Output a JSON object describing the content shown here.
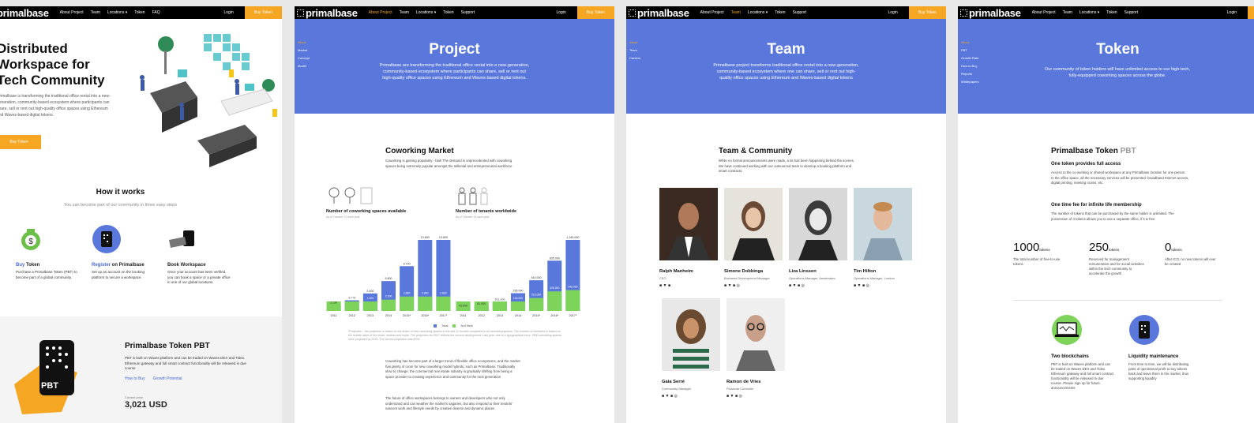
{
  "nav": {
    "logo": "primalbase",
    "about": "About Project",
    "team": "Team",
    "locations": "Locations ▾",
    "token": "Token",
    "faq": "FAQ",
    "support": "Support",
    "login": "Login",
    "buy": "Buy Token"
  },
  "home": {
    "hero_title": "Distributed Workspace for Tech Community",
    "hero_desc": "Primalbase is transforming the traditional office rental into a new-generation, community-based ecosystem where participants can share, sell or rent out high-quality office spaces using Ethereum and Waves-based digital tokens.",
    "hero_button": "Buy Token",
    "how_title": "How it works",
    "how_sub": "You can become part of our community in three easy steps",
    "steps": [
      {
        "hl": "Buy",
        "rest": " Token",
        "desc": "Purchase a Primalbase Token (PBT) to become part of a global community."
      },
      {
        "hl": "Register",
        "rest": " on Primalbase",
        "desc": "Set up an account on the booking platform to secure a workspace."
      },
      {
        "hl": "",
        "rest": "Book Workspace",
        "desc": "Once your account has been verified, you can book a space or a private office in one of our global locations."
      }
    ],
    "pbt_badge": "PBT",
    "pbt_title": "Primalbase Token PBT",
    "pbt_desc": "PBT is built on Waves platform and can be traded on Waves DEX and Tidex. Ethereum gateway and full smart contract functionality will be released in due course",
    "link_how": "How to Buy",
    "link_growth": "Growth Potential",
    "cap_label": "Current price",
    "cap_value": "3,021 USD"
  },
  "project": {
    "side": [
      "About",
      "Market",
      "Concept",
      "Model"
    ],
    "title": "Project",
    "desc": "Primalbase are transforming the traditional office rental into a new-generation, community-based ecosystem where participants can share, sell or rent out high-quality office spaces using Ethereum and Waves-based digital tokens.",
    "market_title": "Coworking Market",
    "market_desc": "Coworking is gaining popularity - fast! The demand is unprecedented with coworking spaces being extremely popular amongst the millenial and entrepreneurial workforce",
    "chart1_title": "Number of coworking spaces available",
    "chart1_sub": "As of October 31 each year",
    "chart2_title": "Number of tenants worldwide",
    "chart2_sub": "As of October 31 each year",
    "legend_total": "Total",
    "legend_new": "Not New",
    "footnote": "*Projection - the projection is based on the share of new coworking spaces in the last 12 months compared to all coworking spaces. The number of members is based on the middle value of the mean, median and mode. The projection for 2017 reflects the current development. Last year, due to a typographical error, 7800 coworking spaces were projected by 2016. The correct projection was 8700.",
    "para1": "Coworking has become part of a larger trend of flexible office ecosystems, and the market has plenty of room for new coworking model hybrids, such as Primalbase. Traditionally slow to change, the commercial real estate industry is gradually shifting from being a space provider to creating experience and community for the next generation",
    "para2": "The future of office workspaces belongs to owners and developers who not only understand and can weather the market's vagaries, but also respond to their tenants' nascent work and lifestyle needs by creative diverse and dynamic places"
  },
  "chart_data": [
    {
      "type": "bar",
      "title": "Number of coworking spaces available",
      "categories": [
        "2011",
        "2012",
        "2013",
        "2014",
        "2015*",
        "2016*",
        "2017*"
      ],
      "series": [
        {
          "name": "Total",
          "values": [
            1130,
            2070,
            3400,
            5800,
            8700,
            13800,
            13800
          ]
        },
        {
          "name": "Not New",
          "values": [
            530,
            940,
            1400,
            2200,
            2800,
            2800,
            2800
          ]
        }
      ],
      "top_labels": [
        "1.130",
        "2.070",
        "3.400",
        "5.800",
        "8.700",
        "13.800",
        "13.800"
      ],
      "inner_labels": [
        "530",
        "940",
        "1.400",
        "2.200",
        "2.800",
        "2.800",
        "2.800"
      ]
    },
    {
      "type": "bar",
      "title": "Number of tenants worldwide",
      "categories": [
        "2011",
        "2012",
        "2013",
        "2014",
        "2015*",
        "2016*",
        "2017*"
      ],
      "series": [
        {
          "name": "Total",
          "values": [
            43900,
            81000,
            151000,
            295000,
            510000,
            835000,
            1180000
          ]
        },
        {
          "name": "Not New",
          "values": [
            20900,
            35000,
            70000,
            144000,
            215000,
            325000,
            346000
          ]
        }
      ],
      "top_labels": [
        "43.900",
        "81.000",
        "151.000",
        "295.000",
        "510.000",
        "835.000",
        "1.180.000"
      ],
      "inner_labels": [
        "20.900",
        "35.000",
        "70.000",
        "144.000",
        "215.000",
        "325.000",
        "346.000"
      ]
    }
  ],
  "team": {
    "side": [
      "About",
      "Team",
      "Careers"
    ],
    "title": "Team",
    "desc": "Primalbase project transforms traditional office rental into a new-generation, community-based ecosystem where one can share, sell or rent out high-quality office spaces using Ethereum and Waves-based digital tokens",
    "sec_title": "Team & Community",
    "sec_desc": "While no formal announcements were made, a lot has been happening behind the scenes. We have continued working with our outsourced team to develop a booking platform and smart contracts.",
    "members": [
      {
        "name": "Ralph Manheim",
        "role": "CEO"
      },
      {
        "name": "Simone Dobbinga",
        "role": "Business Development Manager"
      },
      {
        "name": "Liza Linssen",
        "role": "Operations Manager, Amsterdam"
      },
      {
        "name": "Tim Hilton",
        "role": "Operations Manager, London"
      },
      {
        "name": "Gaia Serré",
        "role": "Community Manager"
      },
      {
        "name": "Ramon de Vries",
        "role": "Financial Controller"
      }
    ]
  },
  "tokenpage": {
    "side": [
      "About",
      "PBT",
      "Growth Rate",
      "How to Buy",
      "Reports",
      "Whitepapers"
    ],
    "title": "Token",
    "desc": "Our community of token holders will have unlimited access to our high-tech, fully-equipped coworking spaces across the globe.",
    "sec_title": "Primalbase Token",
    "sec_title_gray": "PBT",
    "h_access": "One token provides full access",
    "d_access": "Access to the co-working or shared workspace at any Primalbase location for one person. In the office space, all the necessary services will be presented: broadband Internet access, digital printing, meeting rooms, etc.",
    "h_fee": "One time fee for infinite life membership",
    "d_fee": "The number of tokens that can be purchased by the same holder is unlimited. The possession of 4 tokens allows you to use a separate office, if it is free",
    "stats": [
      {
        "num": "1000",
        "unit": "tokens",
        "desc": "The total number of free-to-use tokens"
      },
      {
        "num": "250",
        "unit": "tokens",
        "desc": "Reserved for management remuneration and for social activities within the tech community to accelerate the growth"
      },
      {
        "num": "0",
        "unit": "tokens",
        "desc": "After ICO, no new tokens will ever be created"
      }
    ],
    "features": [
      {
        "title": "Two blockchains",
        "desc": "PBT is built on Waves platform and can be traded on Waves DEX and Tidex. Ethereum gateway and full smart contract functionality will be released in due course. Please sign up for future announcements"
      },
      {
        "title": "Liquidity maintenance",
        "desc": "From time to time, we will be distributing parts of operational profit to buy tokens back and leave them in the market, thus supporting liquidity"
      }
    ]
  },
  "colors": {
    "accent": "#f5a623",
    "blue": "#5a78dc",
    "bar_blue": "#5a78dc",
    "bar_green": "#7ed35a"
  }
}
